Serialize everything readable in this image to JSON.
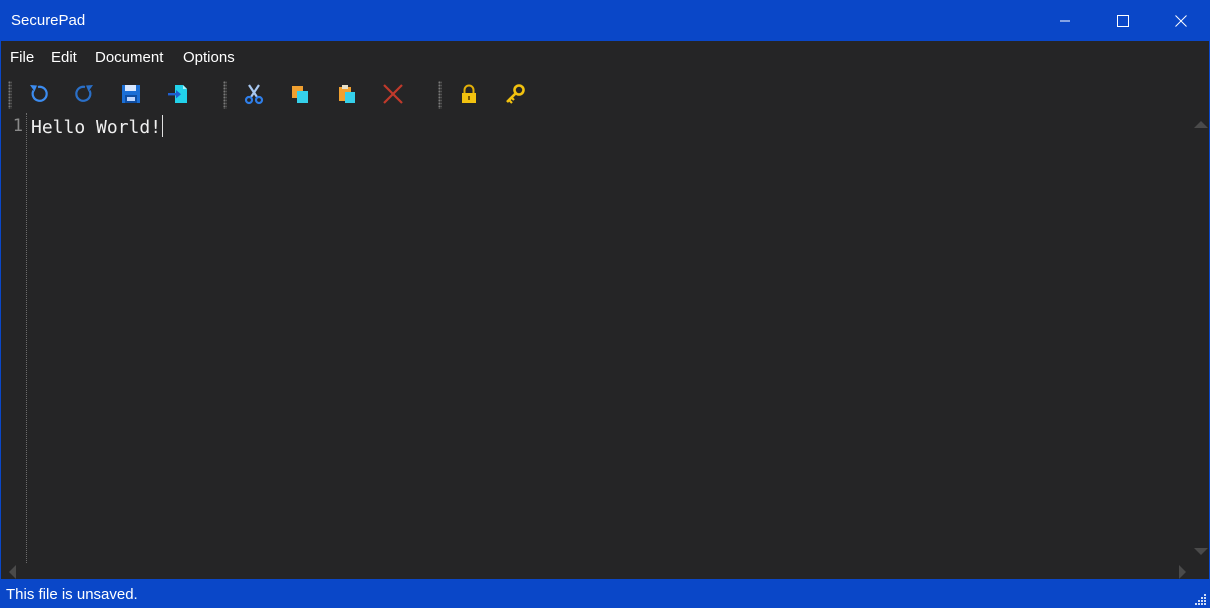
{
  "window": {
    "title": "SecurePad"
  },
  "colors": {
    "accent": "#0a47c8",
    "editor_bg": "#252526"
  },
  "title_buttons": [
    {
      "name": "minimize",
      "icon": "minimize-icon"
    },
    {
      "name": "maximize",
      "icon": "maximize-icon"
    },
    {
      "name": "close",
      "icon": "close-icon"
    }
  ],
  "menu": {
    "items": [
      "File",
      "Edit",
      "Document",
      "Options"
    ]
  },
  "toolbar": {
    "buttons": [
      {
        "icon": "undo-icon"
      },
      {
        "icon": "redo-icon"
      },
      {
        "icon": "save-icon"
      },
      {
        "icon": "export-icon"
      },
      {
        "icon": "cut-icon"
      },
      {
        "icon": "copy-icon"
      },
      {
        "icon": "paste-icon"
      },
      {
        "icon": "delete-icon"
      },
      {
        "icon": "lock-icon"
      },
      {
        "icon": "key-icon"
      }
    ]
  },
  "editor": {
    "lines": [
      {
        "number": "1",
        "text": "Hello World!"
      }
    ]
  },
  "status": {
    "text": "This file is unsaved."
  }
}
